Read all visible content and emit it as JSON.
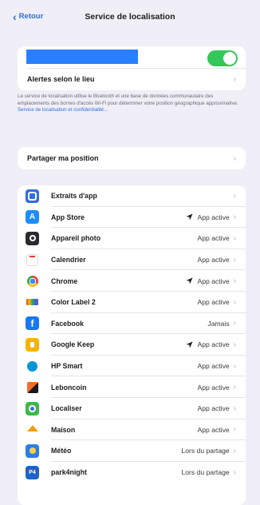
{
  "nav": {
    "back_label": "Retour",
    "title": "Service de localisation"
  },
  "top_card": {
    "toggle_on": true,
    "alerts_label": "Alertes selon le lieu"
  },
  "explanation": {
    "text": "Le service de localisation utilise le Bluetooth et une base de données communautaire des emplacements des bornes d'accès Wi-Fi pour déterminer votre position géographique approximative.",
    "link": "Service de localisation et confidentialité…"
  },
  "share": {
    "label": "Partager ma position"
  },
  "apps": [
    {
      "name": "Extraits d'app",
      "status": "",
      "arrow": false,
      "icon": "app-clips-icon",
      "color": "#2f6fe0"
    },
    {
      "name": "App Store",
      "status": "App active",
      "arrow": true,
      "icon": "app-store-icon",
      "color": "#1e8cff"
    },
    {
      "name": "Appareil photo",
      "status": "App active",
      "arrow": false,
      "icon": "camera-icon",
      "color": "#2b2b2e"
    },
    {
      "name": "Calendrier",
      "status": "App active",
      "arrow": false,
      "icon": "calendar-icon",
      "color": "#ffffff"
    },
    {
      "name": "Chrome",
      "status": "App active",
      "arrow": true,
      "icon": "chrome-icon",
      "color": "#ffffff"
    },
    {
      "name": "Color Label 2",
      "status": "App active",
      "arrow": false,
      "icon": "color-label-icon",
      "color": "#ffffff"
    },
    {
      "name": "Facebook",
      "status": "Jamais",
      "arrow": false,
      "icon": "facebook-icon",
      "color": "#1877f2"
    },
    {
      "name": "Google Keep",
      "status": "App active",
      "arrow": true,
      "icon": "google-keep-icon",
      "color": "#f6b400"
    },
    {
      "name": "HP Smart",
      "status": "App active",
      "arrow": false,
      "icon": "hp-smart-icon",
      "color": "#ffffff"
    },
    {
      "name": "Leboncoin",
      "status": "App active",
      "arrow": false,
      "icon": "leboncoin-icon",
      "color": "#ffffff"
    },
    {
      "name": "Localiser",
      "status": "App active",
      "arrow": false,
      "icon": "find-my-icon",
      "color": "#3fb94a"
    },
    {
      "name": "Maison",
      "status": "App active",
      "arrow": false,
      "icon": "home-icon",
      "color": "#ffffff"
    },
    {
      "name": "Météo",
      "status": "Lors du partage",
      "arrow": false,
      "icon": "weather-icon",
      "color": "#2d7ee6"
    },
    {
      "name": "park4night",
      "status": "Lors du partage",
      "arrow": false,
      "icon": "park4night-icon",
      "color": "#1d63c7"
    }
  ]
}
